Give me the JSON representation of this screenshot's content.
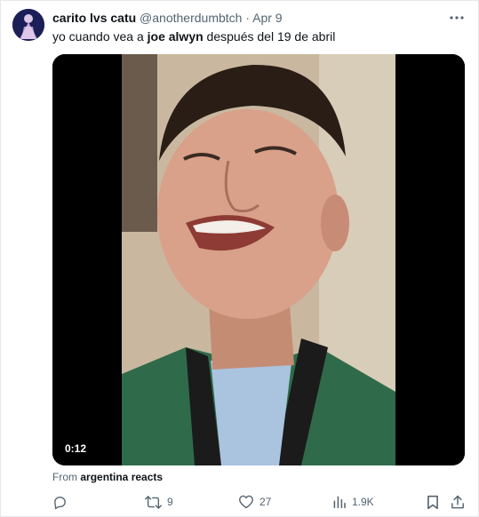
{
  "author": {
    "display_name": "carito lvs catu",
    "handle": "@anotherdumbtch",
    "separator": "·",
    "date": "Apr 9"
  },
  "tweet": {
    "text_before": "yo cuando vea a ",
    "text_bold": "joe alwyn",
    "text_after": " después del 19 de abril"
  },
  "media": {
    "duration": "0:12"
  },
  "source": {
    "prefix": "From ",
    "account": "argentina reacts"
  },
  "actions": {
    "retweets": "9",
    "likes": "27",
    "views": "1.9K"
  },
  "icons": [
    "avatar",
    "more-icon",
    "reply-icon",
    "retweet-icon",
    "like-icon",
    "views-icon",
    "bookmark-icon",
    "share-icon"
  ],
  "colors": {
    "text": "#0f1419",
    "secondary": "#536471",
    "border": "#e6e9ec",
    "avatar_bg": "#1c1f57"
  }
}
